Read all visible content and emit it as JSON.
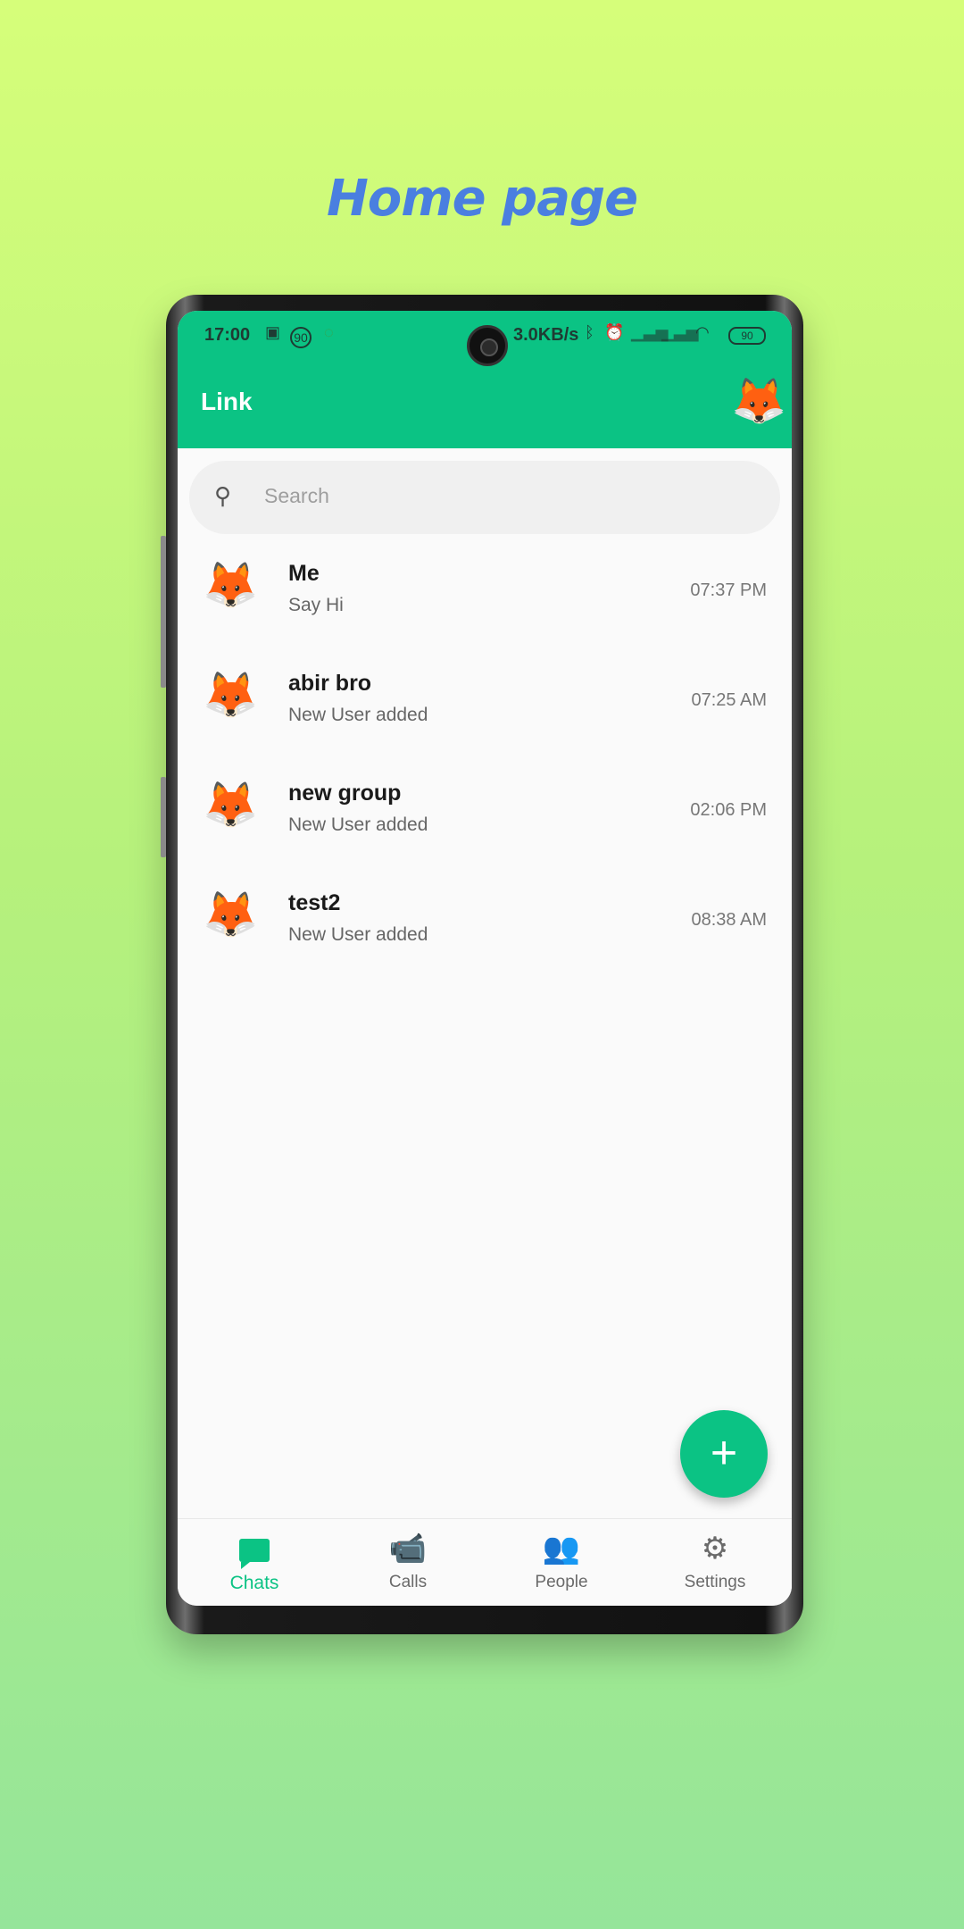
{
  "headline": "Home page",
  "status_bar": {
    "time": "17:00",
    "network_speed": "3.0KB/s",
    "battery": "90",
    "sim_badge": "90"
  },
  "app_bar": {
    "title": "Link",
    "avatar_icon": "fox-icon"
  },
  "search": {
    "placeholder": "Search"
  },
  "chats": [
    {
      "name": "Me",
      "message": "Say Hi",
      "time": "07:37 PM",
      "avatar_icon": "fox-icon"
    },
    {
      "name": "abir bro",
      "message": "New User added",
      "time": "07:25 AM",
      "avatar_icon": "fox-icon"
    },
    {
      "name": "new group",
      "message": "New User added",
      "time": "02:06 PM",
      "avatar_icon": "fox-icon"
    },
    {
      "name": "test2",
      "message": "New User added",
      "time": "08:38 AM",
      "avatar_icon": "fox-icon"
    }
  ],
  "fab": {
    "label": "+"
  },
  "bottom_nav": [
    {
      "label": "Chats",
      "icon": "chat-icon",
      "active": true
    },
    {
      "label": "Calls",
      "icon": "video-call-icon",
      "active": false
    },
    {
      "label": "People",
      "icon": "people-icon",
      "active": false
    },
    {
      "label": "Settings",
      "icon": "gear-icon",
      "active": false
    }
  ],
  "colors": {
    "accent": "#0bc384",
    "headline": "#4a7fe0"
  }
}
